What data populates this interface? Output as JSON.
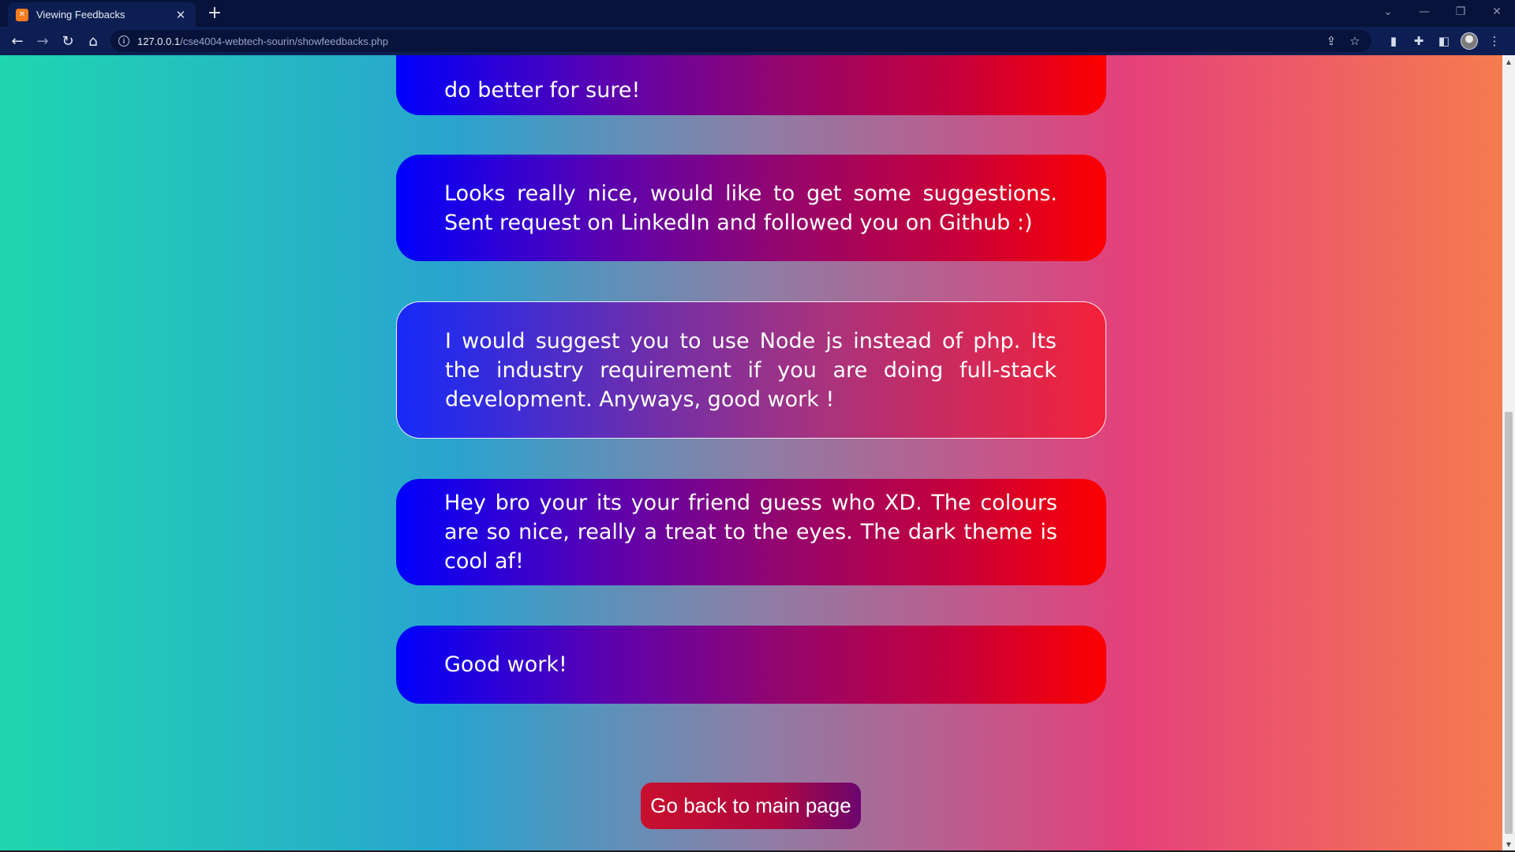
{
  "browser": {
    "tab_title": "Viewing Feedbacks",
    "url_host": "127.0.0.1",
    "url_path": "/cse4004-webtech-sourin/showfeedbacks.php"
  },
  "feedbacks": [
    {
      "text": "do better for sure!"
    },
    {
      "text": "Looks really nice, would like to get some suggestions. Sent request on LinkedIn and followed you on Github :)"
    },
    {
      "text": "I would suggest you to use Node js instead of php. Its the industry requirement if you are doing full-stack development. Anyways, good work !"
    },
    {
      "text": "Hey bro your its your friend guess who XD. The colours are so nice, really a treat to the eyes. The dark theme is cool af!"
    },
    {
      "text": "Good work!"
    }
  ],
  "back_button": {
    "label": "Go back to main page"
  },
  "colors": {
    "card_start": "#0000fb",
    "card_end": "#fd0000",
    "page_left": "#1fd6b0",
    "page_right": "#f57c4f",
    "button": "#c8102e"
  }
}
